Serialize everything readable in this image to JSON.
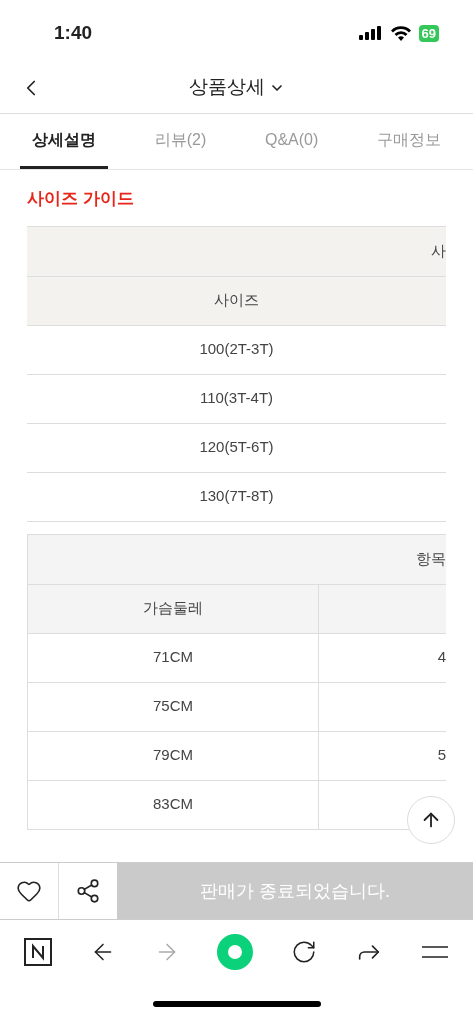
{
  "status_bar": {
    "time": "1:40",
    "battery": "69"
  },
  "header": {
    "title": "상품상세"
  },
  "tabs": [
    {
      "label": "상세설명",
      "selected": true
    },
    {
      "label": "리뷰(2)",
      "selected": false
    },
    {
      "label": "Q&A(0)",
      "selected": false
    },
    {
      "label": "구매정보",
      "selected": false
    }
  ],
  "section_title": "사이즈 가이드",
  "size_table": {
    "group_header": "사",
    "column_header": "사이즈",
    "rows": [
      "100(2T-3T)",
      "110(3T-4T)",
      "120(5T-6T)",
      "130(7T-8T)"
    ]
  },
  "measure_table": {
    "group_header": "항목",
    "columns": [
      "가슴둘레"
    ],
    "rows": [
      [
        "71CM",
        "4"
      ],
      [
        "75CM"
      ],
      [
        "79CM",
        "5"
      ],
      [
        "83CM"
      ]
    ]
  },
  "action_bar": {
    "message": "판매가 종료되었습니다."
  }
}
